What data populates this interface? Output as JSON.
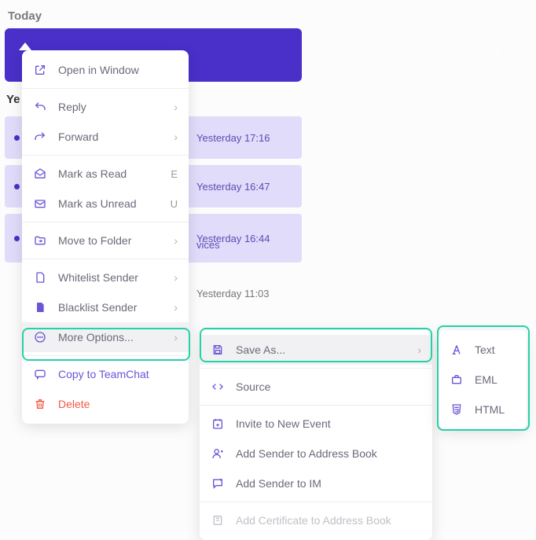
{
  "header": {
    "today": "Today",
    "yesterday": "Yesterday"
  },
  "selected": {
    "time": "00:07"
  },
  "rows": {
    "r1": {
      "time": "Yesterday 17:16"
    },
    "r2": {
      "time": "Yesterday 16:47"
    },
    "r3": {
      "time": "Yesterday 16:44",
      "subject": "vices"
    },
    "r4": {
      "time": "Yesterday 11:03"
    }
  },
  "menu": {
    "open_window": "Open in Window",
    "reply": "Reply",
    "forward": "Forward",
    "mark_read": "Mark as Read",
    "mark_read_key": "E",
    "mark_unread": "Mark as Unread",
    "mark_unread_key": "U",
    "move_folder": "Move to Folder",
    "whitelist": "Whitelist Sender",
    "blacklist": "Blacklist Sender",
    "more_options": "More Options...",
    "copy_teamchat": "Copy to TeamChat",
    "delete": "Delete"
  },
  "submenu": {
    "save_as": "Save As...",
    "source": "Source",
    "invite_event": "Invite to New Event",
    "add_sender_ab": "Add Sender to Address Book",
    "add_sender_im": "Add Sender to IM",
    "add_cert_ab": "Add Certificate to Address Book"
  },
  "savemenu": {
    "text": "Text",
    "eml": "EML",
    "html": "HTML"
  }
}
